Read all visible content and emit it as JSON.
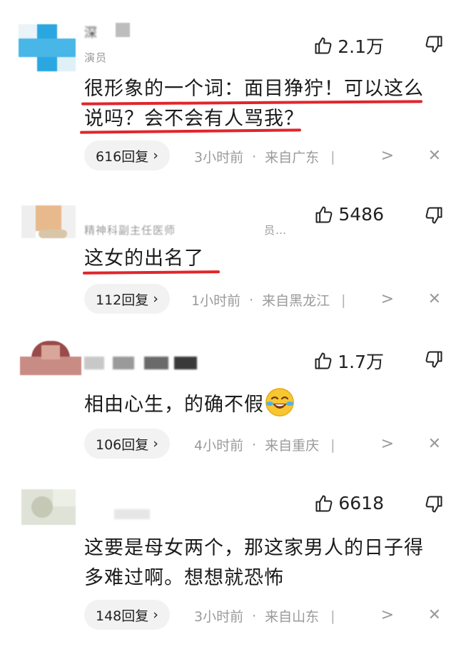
{
  "comments": [
    {
      "name": "深",
      "role": "演员",
      "likes": "2.1万",
      "text_lines": [
        "很形象的一个词：面目狰狞！可以这么",
        "说吗？会不会有人骂我？"
      ],
      "replies": "616回复",
      "time": "3小时前",
      "location": "来自广东"
    },
    {
      "role": "精神科副主任医师",
      "role_suffix": "员…",
      "likes": "5486",
      "text_lines": [
        "这女的出名了"
      ],
      "replies": "112回复",
      "time": "1小时前",
      "location": "来自黑龙江"
    },
    {
      "likes": "1.7万",
      "text_lines": [
        "相由心生，的确不假"
      ],
      "emoji": "laughing-crying-emoji",
      "replies": "106回复",
      "time": "4小时前",
      "location": "来自重庆"
    },
    {
      "likes": "6618",
      "text_lines": [
        "这要是母女两个，那这家男人的日子得",
        "多难过啊。想想就恐怖"
      ],
      "replies": "148回复",
      "time": "3小时前",
      "location": "来自山东"
    }
  ],
  "reply_chevron": "›",
  "dot": "·",
  "separator": "|",
  "chevron": ">",
  "close": "✕",
  "colors": {
    "underline": "#e0262b",
    "meta": "#9a9a9a",
    "pill": "#f2f2f2"
  },
  "icons": {
    "like": "thumbs-up-icon",
    "dislike": "thumbs-down-icon"
  }
}
